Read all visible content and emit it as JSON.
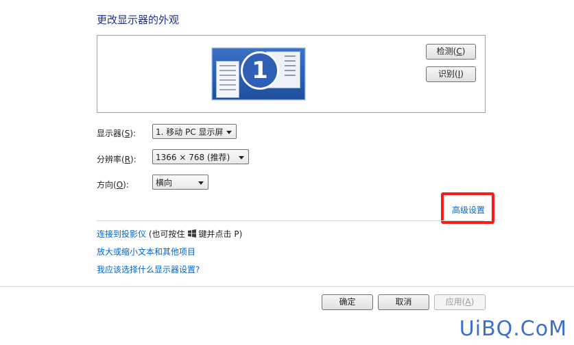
{
  "page": {
    "title": "更改显示器的外观"
  },
  "preview": {
    "monitor_number": "1"
  },
  "buttons": {
    "detect_text": "检测",
    "detect_key": "C",
    "identify_text": "识别",
    "identify_key": "I",
    "ok": "确定",
    "cancel": "取消",
    "apply_text": "应用",
    "apply_key": "A"
  },
  "fields": {
    "display": {
      "label_text": "显示器",
      "label_key": "S",
      "value": "1. 移动 PC 显示屏"
    },
    "resolution": {
      "label_text": "分辨率",
      "label_key": "R",
      "value": "1366 × 768 (推荐)"
    },
    "orientation": {
      "label_text": "方向",
      "label_key": "O",
      "value": "横向"
    }
  },
  "advanced_link": "高级设置",
  "links": {
    "projector": "连接到投影仪",
    "projector_hint_pre": "(也可按住",
    "projector_hint_post": "键并点击 P)",
    "text_size": "放大或缩小文本和其他项目",
    "which_settings": "我应该选择什么显示器设置?"
  },
  "watermark": "UiBQ.CoM",
  "colors": {
    "link": "#0066cc",
    "highlight_box": "#ff1a1a",
    "title": "#1e3287"
  },
  "icons": {
    "windows_key": "windows-logo-icon",
    "dropdown": "chevron-down-icon"
  }
}
